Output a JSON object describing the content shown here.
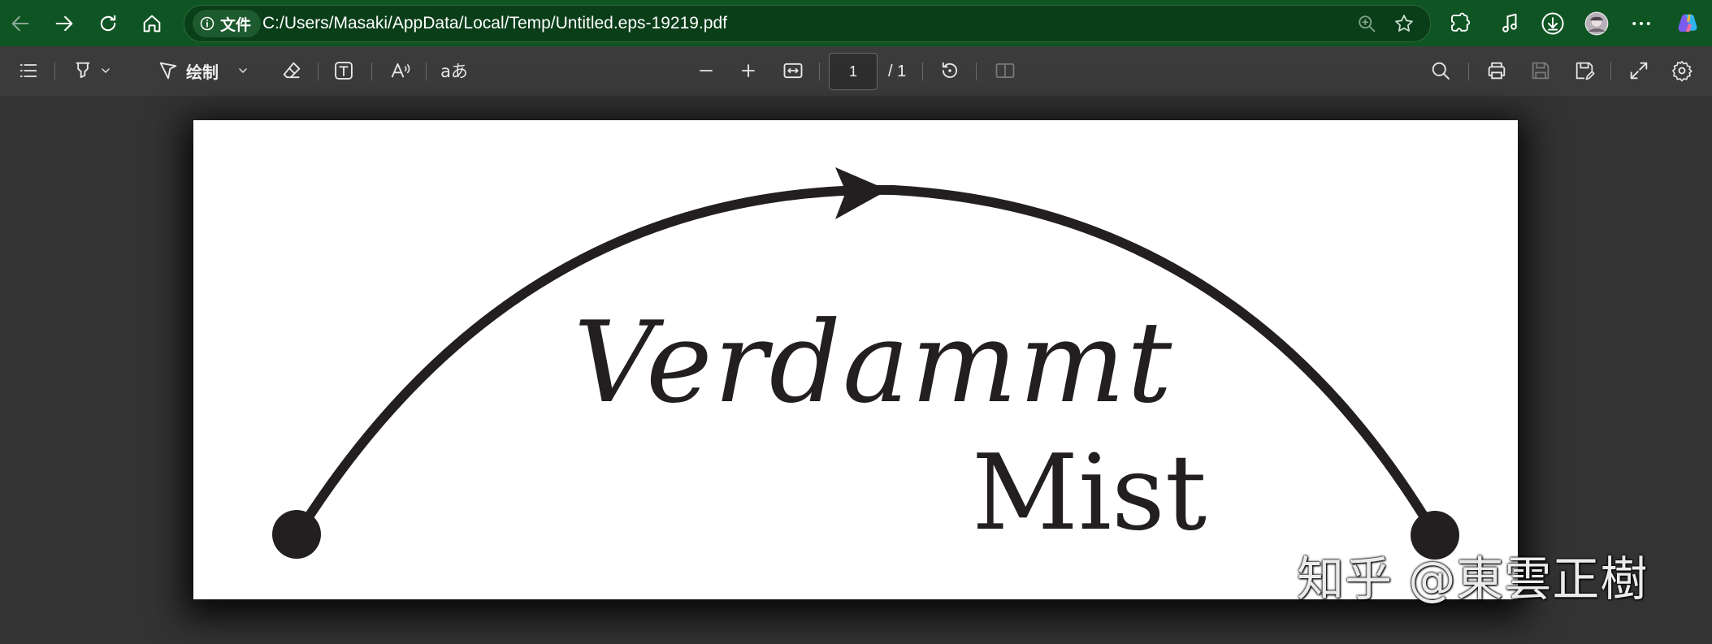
{
  "browser": {
    "site_label": "文件",
    "url": "C:/Users/Masaki/AppData/Local/Temp/Untitled.eps-19219.pdf",
    "icons": {
      "back": "back-arrow-icon",
      "forward": "forward-arrow-icon",
      "refresh": "refresh-icon",
      "home": "home-icon",
      "info": "info-icon",
      "zoom": "zoom-icon",
      "favorite": "star-icon",
      "extensions": "puzzle-icon",
      "media": "music-note-icon",
      "downloads": "download-icon",
      "profile": "avatar",
      "more": "more-icon",
      "copilot": "copilot-icon"
    },
    "colors": {
      "frame": "#0f5423",
      "address": "#0a3e19"
    }
  },
  "toolbar": {
    "draw_label": "绘制",
    "text_lang_label": "aあ",
    "page_current": "1",
    "page_total": "/ 1",
    "icons": [
      "contents-icon",
      "highlight-icon",
      "draw-icon",
      "eraser-icon",
      "text-box-icon",
      "read-aloud-icon",
      "translate-icon",
      "zoom-out-icon",
      "zoom-in-icon",
      "fit-width-icon",
      "rotate-icon",
      "page-view-icon",
      "search-icon",
      "print-icon",
      "save-icon",
      "save-as-icon",
      "fullscreen-icon",
      "settings-icon"
    ]
  },
  "document": {
    "line1": "Verdammt",
    "line2": "Mist",
    "colors": {
      "ink": "#231f20",
      "page": "#ffffff"
    }
  },
  "watermark": {
    "text": "知乎 @東雲正樹"
  }
}
